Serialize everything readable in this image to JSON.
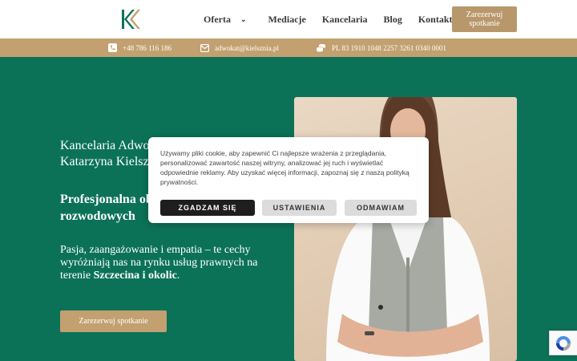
{
  "header": {
    "logo_letters": "KK",
    "nav": [
      {
        "label": "Oferta",
        "has_dropdown": true
      },
      {
        "label": "Mediacje"
      },
      {
        "label": "Kancelaria"
      },
      {
        "label": "Blog"
      },
      {
        "label": "Kontakt"
      }
    ],
    "cta_label": "Zarezerwuj spotkanie"
  },
  "infobar": {
    "phone": "+48 786 116 186",
    "email": "adwokat@kielsznia.pl",
    "bank": "PL 83 1910 1048 2257 3261 0340 0001"
  },
  "hero": {
    "title": "Kancelaria Adwokacka\nKatarzyna Kielsznia",
    "subtitle": "Profesjonalna obsługa spraw\nrozwodowych",
    "text_lead": "Pasja, zaangażowanie i empatia – te cechy wyróżniają nas na rynku usług prawnych na terenie ",
    "text_bold": "Szczecina i okolic",
    "text_end": ".",
    "cta_label": "Zarezerwuj spotkanie"
  },
  "cookie": {
    "message": "Używamy pliki cookie, aby zapewnić Ci najlepsze wrażenia z przeglądania, personalizować zawartość naszej witryny, analizować jej ruch i wyświetlać odpowiednie reklamy. Aby uzyskać więcej informacji, zapoznaj się z naszą ",
    "link_text": "polityką prywatności",
    "message_end": ".",
    "accept": "ZGADZAM SIĘ",
    "settings": "USTAWIENIA",
    "reject": "ODMAWIAM"
  },
  "colors": {
    "green": "#0b7258",
    "gold": "#c2a06f",
    "dark_button": "#1e1e1e"
  },
  "icons": [
    "phone-icon",
    "envelope-icon",
    "coins-icon",
    "recaptcha-icon",
    "chevron-down-icon"
  ]
}
